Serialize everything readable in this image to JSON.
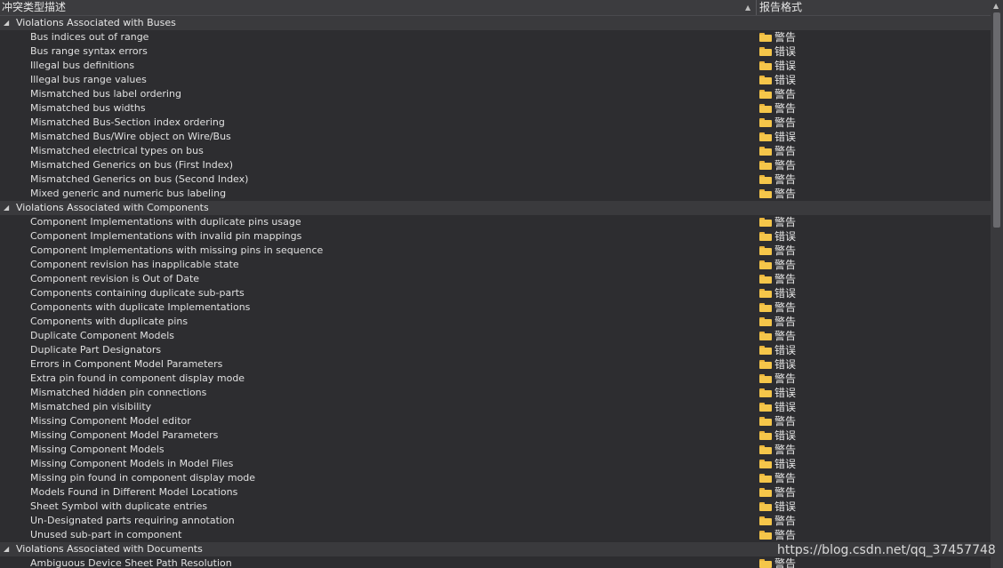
{
  "header": {
    "col_description": "冲突类型描述",
    "col_format": "报告格式"
  },
  "groups": [
    {
      "title": "Violations Associated with Buses",
      "items": [
        {
          "label": "Bus indices out of range",
          "format": "警告"
        },
        {
          "label": "Bus range syntax errors",
          "format": "错误"
        },
        {
          "label": "Illegal bus definitions",
          "format": "错误"
        },
        {
          "label": "Illegal bus range values",
          "format": "错误"
        },
        {
          "label": "Mismatched bus label ordering",
          "format": "警告"
        },
        {
          "label": "Mismatched bus widths",
          "format": "警告"
        },
        {
          "label": "Mismatched Bus-Section index ordering",
          "format": "警告"
        },
        {
          "label": "Mismatched Bus/Wire object on Wire/Bus",
          "format": "错误"
        },
        {
          "label": "Mismatched electrical types on bus",
          "format": "警告"
        },
        {
          "label": "Mismatched Generics on bus (First Index)",
          "format": "警告"
        },
        {
          "label": "Mismatched Generics on bus (Second Index)",
          "format": "警告"
        },
        {
          "label": "Mixed generic and numeric bus labeling",
          "format": "警告"
        }
      ]
    },
    {
      "title": "Violations Associated with Components",
      "items": [
        {
          "label": "Component Implementations with duplicate pins usage",
          "format": "警告"
        },
        {
          "label": "Component Implementations with invalid pin mappings",
          "format": "错误"
        },
        {
          "label": "Component Implementations with missing pins in sequence",
          "format": "警告"
        },
        {
          "label": "Component revision has inapplicable state",
          "format": "警告"
        },
        {
          "label": "Component revision is Out of Date",
          "format": "警告"
        },
        {
          "label": "Components containing duplicate sub-parts",
          "format": "错误"
        },
        {
          "label": "Components with duplicate Implementations",
          "format": "警告"
        },
        {
          "label": "Components with duplicate pins",
          "format": "警告"
        },
        {
          "label": "Duplicate Component Models",
          "format": "警告"
        },
        {
          "label": "Duplicate Part Designators",
          "format": "错误"
        },
        {
          "label": "Errors in Component Model Parameters",
          "format": "错误"
        },
        {
          "label": "Extra pin found in component display mode",
          "format": "警告"
        },
        {
          "label": "Mismatched hidden pin connections",
          "format": "错误"
        },
        {
          "label": "Mismatched pin visibility",
          "format": "错误"
        },
        {
          "label": "Missing Component Model editor",
          "format": "警告"
        },
        {
          "label": "Missing Component Model Parameters",
          "format": "错误"
        },
        {
          "label": "Missing Component Models",
          "format": "警告"
        },
        {
          "label": "Missing Component Models in Model Files",
          "format": "错误"
        },
        {
          "label": "Missing pin found in component display mode",
          "format": "警告"
        },
        {
          "label": "Models Found in Different Model Locations",
          "format": "警告"
        },
        {
          "label": "Sheet Symbol with duplicate entries",
          "format": "错误"
        },
        {
          "label": "Un-Designated parts requiring annotation",
          "format": "警告"
        },
        {
          "label": "Unused sub-part in component",
          "format": "警告"
        }
      ]
    },
    {
      "title": "Violations Associated with Documents",
      "items": [
        {
          "label": "Ambiguous Device Sheet Path Resolution",
          "format": "警告"
        }
      ]
    }
  ],
  "watermark": "https://blog.csdn.net/qq_37457748",
  "colors": {
    "background": "#2d2d30",
    "group_row": "#3a3a3d",
    "folder": "#f5c64a",
    "text": "#e0e0e0"
  },
  "icons": {
    "format_icon": "folder-icon",
    "group_toggle": "collapse-triangle-icon",
    "sort": "sort-up-icon"
  }
}
